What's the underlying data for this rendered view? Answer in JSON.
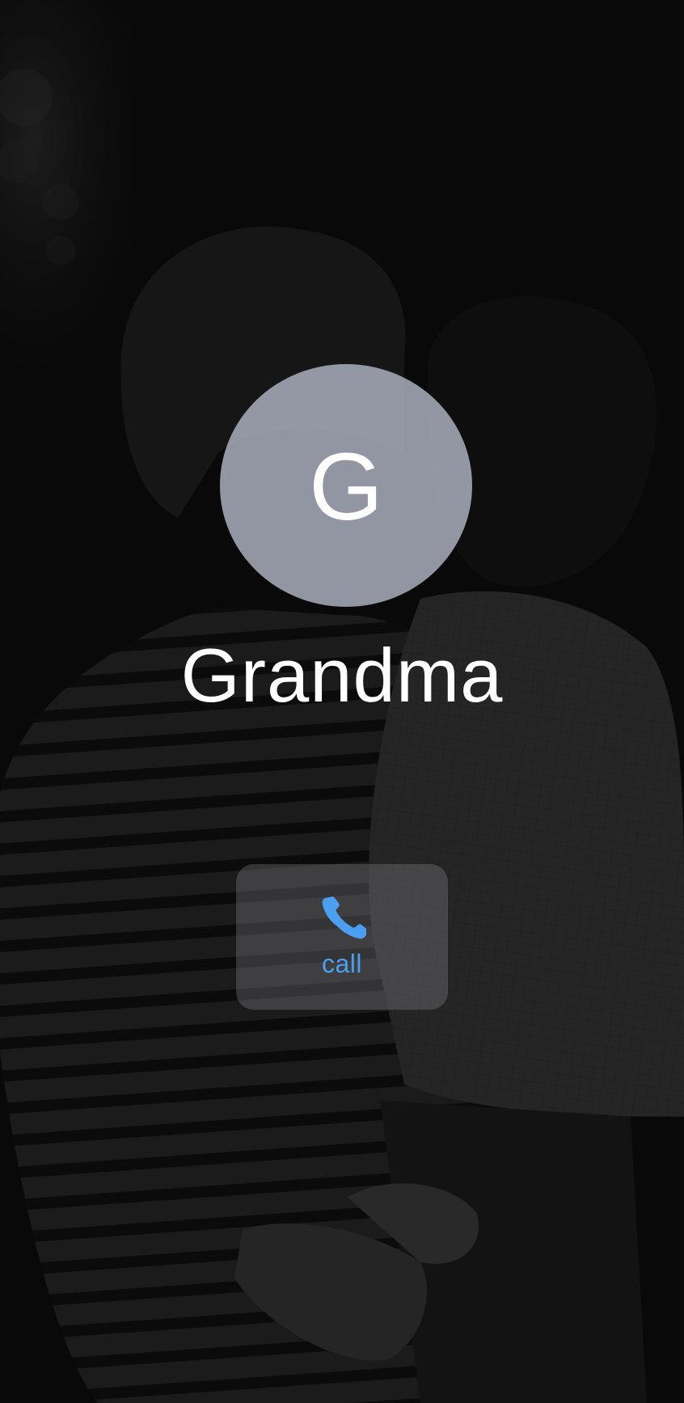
{
  "contact": {
    "initial": "G",
    "name": "Grandma"
  },
  "actions": {
    "call_label": "call",
    "call_icon": "phone-icon"
  },
  "colors": {
    "accent": "#4a9ff0",
    "avatar_bg": "#b9becd",
    "text": "#ffffff"
  }
}
